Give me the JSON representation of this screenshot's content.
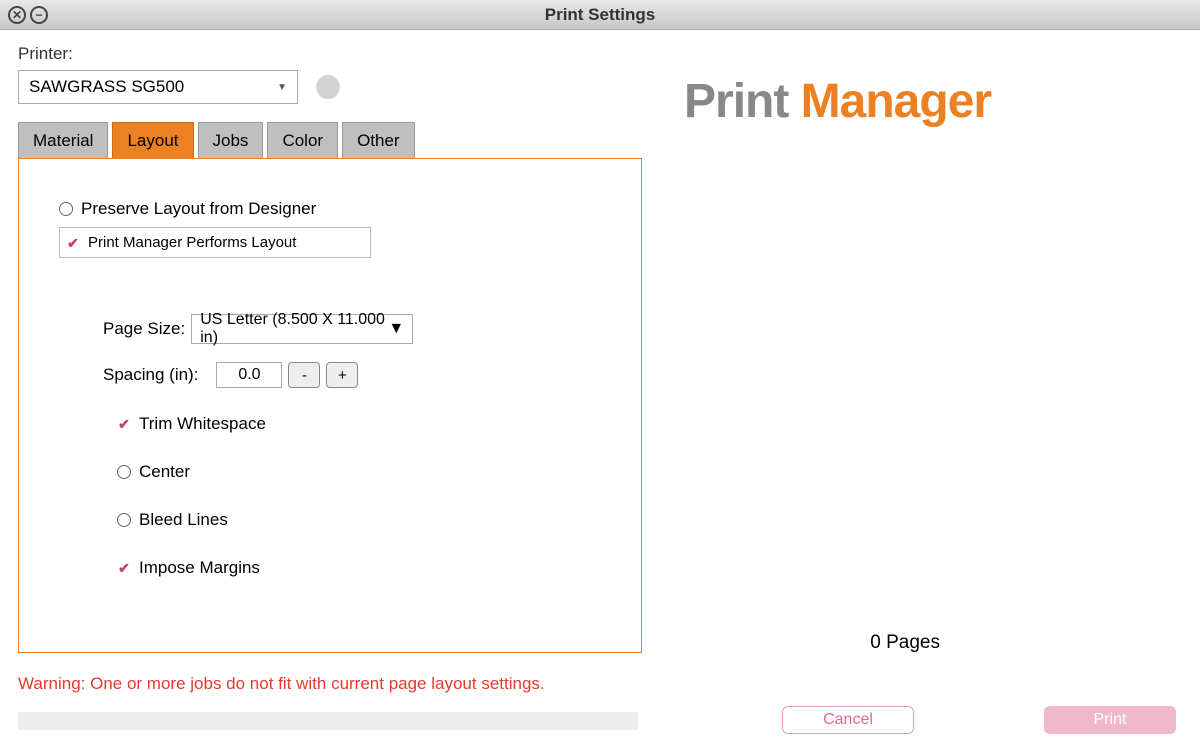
{
  "window": {
    "title": "Print Settings"
  },
  "printer": {
    "label": "Printer:",
    "selected": "SAWGRASS SG500"
  },
  "tabs": {
    "material": "Material",
    "layout": "Layout",
    "jobs": "Jobs",
    "color": "Color",
    "other": "Other"
  },
  "layout_mode": {
    "preserve": "Preserve Layout from Designer",
    "perform": "Print Manager Performs Layout"
  },
  "page": {
    "size_label": "Page Size:",
    "size_value": "US Letter (8.500 X 11.000 in)",
    "spacing_label": "Spacing (in):",
    "spacing_value": "0.0",
    "minus": "-",
    "plus": "+"
  },
  "options": {
    "trim": "Trim Whitespace",
    "center": "Center",
    "bleed": "Bleed Lines",
    "margins": "Impose Margins"
  },
  "warning": "Warning:  One or more jobs do not fit with current page layout settings.",
  "logo": {
    "a": "Print ",
    "b": "Manager"
  },
  "pages_count": "0 Pages",
  "buttons": {
    "cancel": "Cancel",
    "print": "Print"
  }
}
